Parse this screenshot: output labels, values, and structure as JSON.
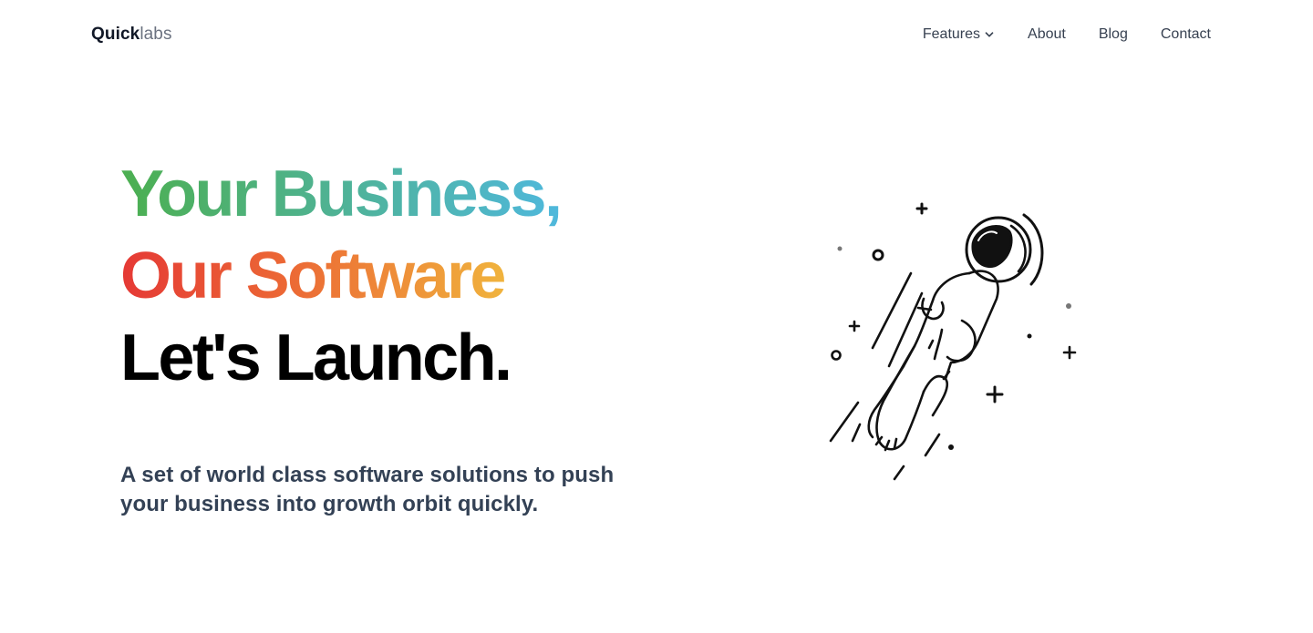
{
  "nav": {
    "logo_bold": "Quick",
    "logo_light": "labs",
    "items": [
      {
        "label": "Features"
      },
      {
        "label": "About"
      },
      {
        "label": "Blog"
      },
      {
        "label": "Contact"
      }
    ]
  },
  "hero": {
    "line1": "Your Business,",
    "line2": "Our Software",
    "line3": "Let's Launch.",
    "subtitle": "A set of world class software solutions to push your business into growth orbit quickly."
  },
  "colors": {
    "green": "#4caf50",
    "teal": "#4fb8dc",
    "red": "#e53935",
    "orange": "#f0b33d",
    "text": "#334155"
  },
  "illustration": {
    "icon": "astronaut-flying-icon"
  }
}
